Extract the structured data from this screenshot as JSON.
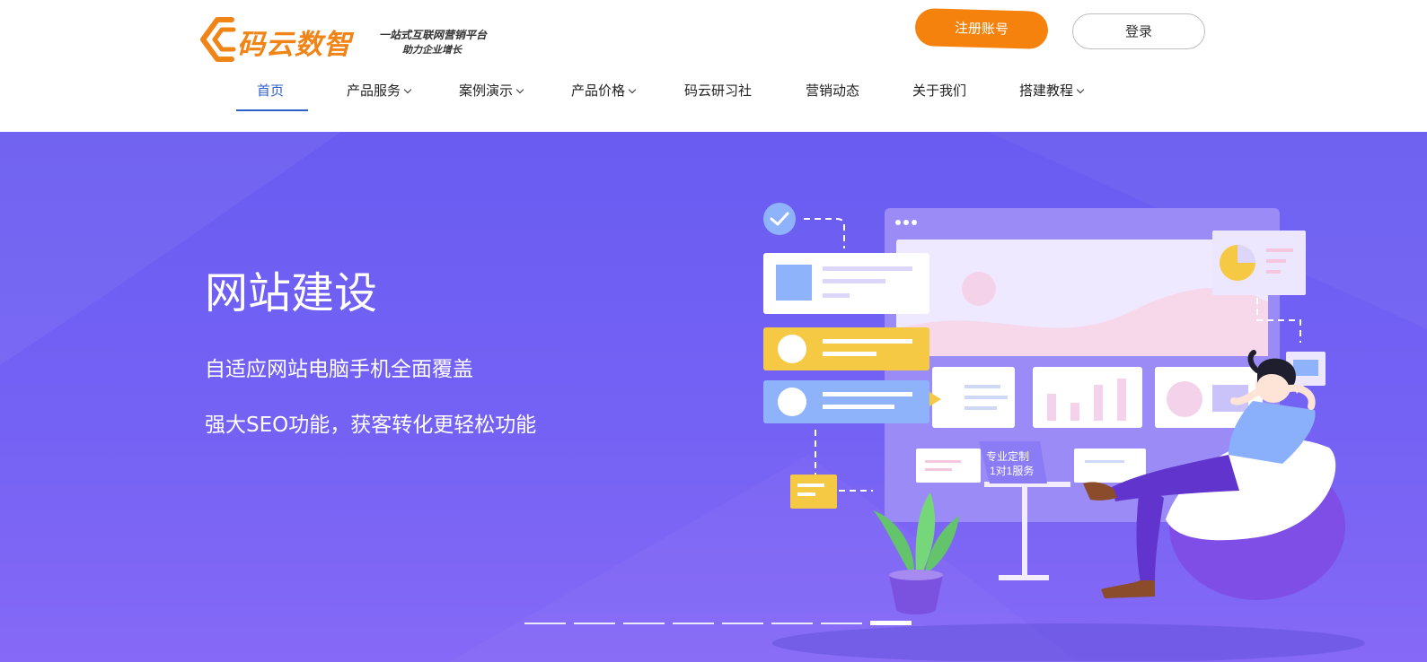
{
  "brand": {
    "name": "码云数智",
    "slogan_line1": "一站式互联网营销平台",
    "slogan_line2": "助力企业增长",
    "color": "#f08417"
  },
  "header": {
    "register_label": "注册账号",
    "login_label": "登录"
  },
  "nav": {
    "items": [
      {
        "label": "首页",
        "active": true,
        "dropdown": false
      },
      {
        "label": "产品服务",
        "active": false,
        "dropdown": true
      },
      {
        "label": "案例演示",
        "active": false,
        "dropdown": true
      },
      {
        "label": "产品价格",
        "active": false,
        "dropdown": true
      },
      {
        "label": "码云研习社",
        "active": false,
        "dropdown": false
      },
      {
        "label": "营销动态",
        "active": false,
        "dropdown": false
      },
      {
        "label": "关于我们",
        "active": false,
        "dropdown": false
      },
      {
        "label": "搭建教程",
        "active": false,
        "dropdown": true
      }
    ],
    "active_color": "#2f5fc9"
  },
  "banner": {
    "title": "网站建设",
    "subtitle1": "自适应网站电脑手机全面覆盖",
    "subtitle2": "强大SEO功能，获客转化更轻松功能",
    "illustration_badge_line1": "专业定制",
    "illustration_badge_line2": "1对1服务",
    "slides_count": 8,
    "active_slide": 8
  },
  "colors": {
    "banner_top": "#6a5cf1",
    "banner_bottom": "#8669f6",
    "register_button": "#f5820c"
  }
}
